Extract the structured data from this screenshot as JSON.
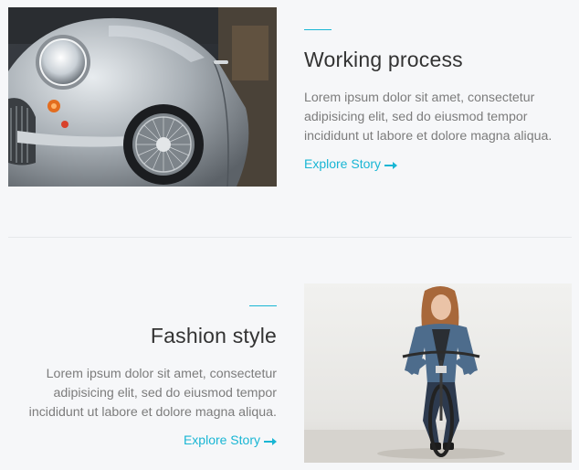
{
  "sections": [
    {
      "title": "Working process",
      "description": "Lorem ipsum dolor sit amet, consectetur adipisicing elit, sed do eiusmod tempor incididunt ut labore et dolore magna aliqua.",
      "link_label": "Explore Story"
    },
    {
      "title": "Fashion style",
      "description": "Lorem ipsum dolor sit amet, consectetur adipisicing elit, sed do eiusmod tempor incididunt ut labore et dolore magna aliqua.",
      "link_label": "Explore Story"
    }
  ],
  "colors": {
    "accent": "#19b6d4",
    "background": "#f6f7f9",
    "title": "#333333",
    "text": "#7c7c7c"
  },
  "icons": {
    "link_arrow": "long-arrow-right-icon"
  }
}
